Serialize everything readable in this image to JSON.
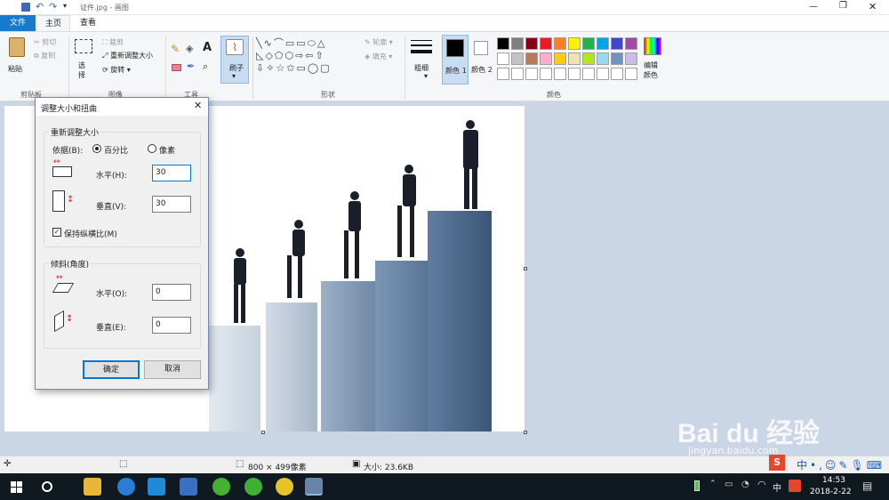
{
  "window": {
    "title": "证件.jpg - 画图"
  },
  "menu": {
    "file": "文件",
    "home": "主页",
    "view": "查看"
  },
  "ribbon": {
    "clipboard": {
      "paste": "粘贴",
      "cut": "剪切",
      "copy": "复制",
      "label": "剪贴板"
    },
    "image": {
      "select": "选\n择",
      "crop": "裁剪",
      "resize": "重新调整大小",
      "rotate": "旋转",
      "label": "图像"
    },
    "tools": {
      "label": "工具"
    },
    "brush": {
      "label": "刷子"
    },
    "shapes": {
      "label": "形状",
      "outline": "轮廓",
      "fill": "填充"
    },
    "size": {
      "label": "粗细"
    },
    "color1": {
      "label": "颜色 1"
    },
    "color2": {
      "label": "颜色 2"
    },
    "colors": {
      "label": "颜色",
      "edit": "编辑颜色"
    },
    "palette": [
      "#000000",
      "#7f7f7f",
      "#880015",
      "#ed1c24",
      "#ff7f27",
      "#fff200",
      "#22b14c",
      "#00a2e8",
      "#3f48cc",
      "#a349a4",
      "#ffffff",
      "#c3c3c3",
      "#b97a57",
      "#ffaec9",
      "#ffc90e",
      "#efe4b0",
      "#b5e61d",
      "#99d9ea",
      "#7092be",
      "#c8bfe7"
    ]
  },
  "dialog": {
    "title": "调整大小和扭曲",
    "resize_group": "重新调整大小",
    "by_label": "依据(B):",
    "percent": "百分比",
    "pixels": "像素",
    "horizontal_label": "水平(H):",
    "horizontal_value": "30",
    "vertical_label": "垂直(V):",
    "vertical_value": "30",
    "keep_ratio": "保持纵横比(M)",
    "skew_group": "倾斜(角度)",
    "skew_h_label": "水平(O):",
    "skew_h_value": "0",
    "skew_v_label": "垂直(E):",
    "skew_v_value": "0",
    "ok": "确定",
    "cancel": "取消"
  },
  "status": {
    "dimensions": "800 × 499像素",
    "size": "大小: 23.6KB"
  },
  "taskbar": {
    "time": "14:53",
    "date": "2018-2-22",
    "ime": "中",
    "ime_icon": "中"
  },
  "watermark": {
    "brand": "Bai du 经验",
    "url": "jingyan.baidu.com"
  }
}
